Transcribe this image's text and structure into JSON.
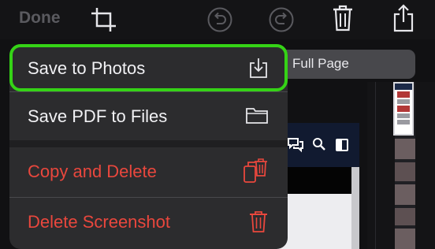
{
  "toolbar": {
    "done_label": "Done",
    "icons": [
      "crop-icon",
      "undo-icon",
      "redo-icon",
      "trash-icon",
      "share-icon"
    ]
  },
  "segment": {
    "label": "Full Page"
  },
  "menu": {
    "items": [
      {
        "label": "Save to Photos",
        "icon": "save-to-photos-icon",
        "destructive": false,
        "highlighted": true
      },
      {
        "label": "Save PDF to Files",
        "icon": "folder-icon",
        "destructive": false,
        "highlighted": false
      },
      {
        "label": "Copy and Delete",
        "icon": "copy-delete-icon",
        "destructive": true,
        "highlighted": false
      },
      {
        "label": "Delete Screenshot",
        "icon": "trash-icon",
        "destructive": true,
        "highlighted": false
      }
    ]
  },
  "colors": {
    "highlight": "#35d316",
    "destructive": "#e9473d",
    "menu_background": "#2c2c2e"
  }
}
